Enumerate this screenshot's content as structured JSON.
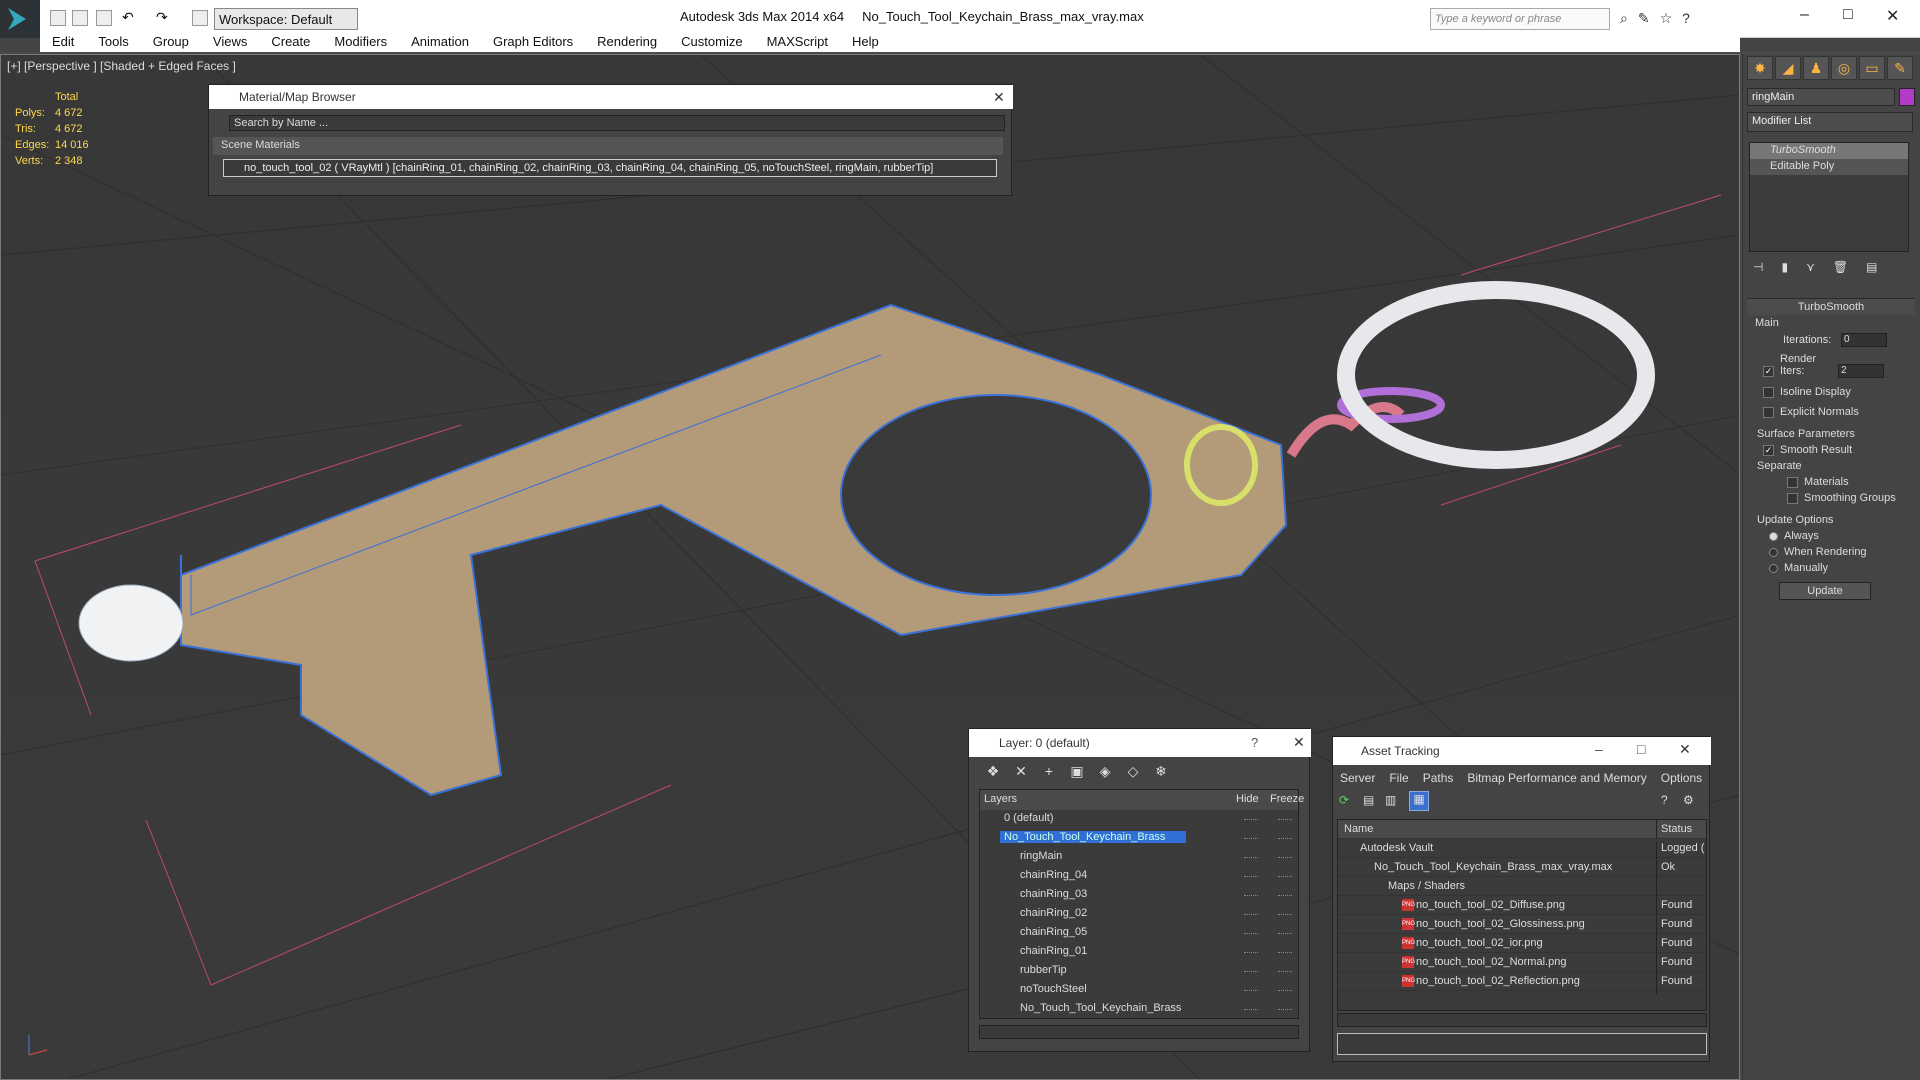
{
  "titlebar": {
    "workspace": "Workspace: Default",
    "app": "Autodesk 3ds Max  2014 x64",
    "file": "No_Touch_Tool_Keychain_Brass_max_vray.max",
    "search_placeholder": "Type a keyword or phrase"
  },
  "menu": [
    "Edit",
    "Tools",
    "Group",
    "Views",
    "Create",
    "Modifiers",
    "Animation",
    "Graph Editors",
    "Rendering",
    "Customize",
    "MAXScript",
    "Help"
  ],
  "viewport": {
    "label": "[+] [Perspective ] [Shaded + Edged Faces ]",
    "stats_header": "Total",
    "stats": [
      {
        "label": "Polys:",
        "value": "4 672"
      },
      {
        "label": "Tris:",
        "value": "4 672"
      },
      {
        "label": "Edges:",
        "value": "14 016"
      },
      {
        "label": "Verts:",
        "value": "2 348"
      }
    ]
  },
  "material_browser": {
    "title": "Material/Map Browser",
    "search": "Search by Name ...",
    "section": "Scene Materials",
    "material": "no_touch_tool_02  ( VRayMtl ) [chainRing_01, chainRing_02, chainRing_03, chainRing_04, chainRing_05, noTouchSteel, ringMain, rubberTip]"
  },
  "command_panel": {
    "object_name": "ringMain",
    "modifier_list": "Modifier List",
    "color": "#b03cc8",
    "stack": [
      "TurboSmooth",
      "Editable Poly"
    ],
    "rollout_title": "TurboSmooth",
    "main_label": "Main",
    "iterations_label": "Iterations:",
    "iterations": "0",
    "render_iters_label": "Render Iters:",
    "render_iters": "2",
    "isoline": "Isoline Display",
    "explicit": "Explicit Normals",
    "surface": "Surface Parameters",
    "smooth": "Smooth Result",
    "separate": "Separate",
    "materials": "Materials",
    "smoothing_groups": "Smoothing Groups",
    "update_options": "Update Options",
    "always": "Always",
    "when_rendering": "When Rendering",
    "manually": "Manually",
    "update": "Update"
  },
  "layer": {
    "title": "Layer: 0 (default)",
    "col_layers": "Layers",
    "col_hide": "Hide",
    "col_freeze": "Freeze",
    "rows": [
      {
        "name": "0 (default)",
        "indent": 0
      },
      {
        "name": "No_Touch_Tool_Keychain_Brass",
        "indent": 0,
        "selected": true
      },
      {
        "name": "ringMain",
        "indent": 1
      },
      {
        "name": "chainRing_04",
        "indent": 1
      },
      {
        "name": "chainRing_03",
        "indent": 1
      },
      {
        "name": "chainRing_02",
        "indent": 1
      },
      {
        "name": "chainRing_05",
        "indent": 1
      },
      {
        "name": "chainRing_01",
        "indent": 1
      },
      {
        "name": "rubberTip",
        "indent": 1
      },
      {
        "name": "noTouchSteel",
        "indent": 1
      },
      {
        "name": "No_Touch_Tool_Keychain_Brass",
        "indent": 1
      }
    ]
  },
  "asset": {
    "title": "Asset Tracking",
    "menu": [
      "Server",
      "File",
      "Paths",
      "Bitmap Performance and Memory",
      "Options"
    ],
    "col_name": "Name",
    "col_status": "Status",
    "rows": [
      {
        "name": "Autodesk Vault",
        "status": "Logged (",
        "indent": 1
      },
      {
        "name": "No_Touch_Tool_Keychain_Brass_max_vray.max",
        "status": "Ok",
        "indent": 2
      },
      {
        "name": "Maps / Shaders",
        "status": "",
        "indent": 3
      },
      {
        "name": "no_touch_tool_02_Diffuse.png",
        "status": "Found",
        "indent": 4,
        "png": true
      },
      {
        "name": "no_touch_tool_02_Glossiness.png",
        "status": "Found",
        "indent": 4,
        "png": true
      },
      {
        "name": "no_touch_tool_02_ior.png",
        "status": "Found",
        "indent": 4,
        "png": true
      },
      {
        "name": "no_touch_tool_02_Normal.png",
        "status": "Found",
        "indent": 4,
        "png": true
      },
      {
        "name": "no_touch_tool_02_Reflection.png",
        "status": "Found",
        "indent": 4,
        "png": true
      }
    ]
  }
}
